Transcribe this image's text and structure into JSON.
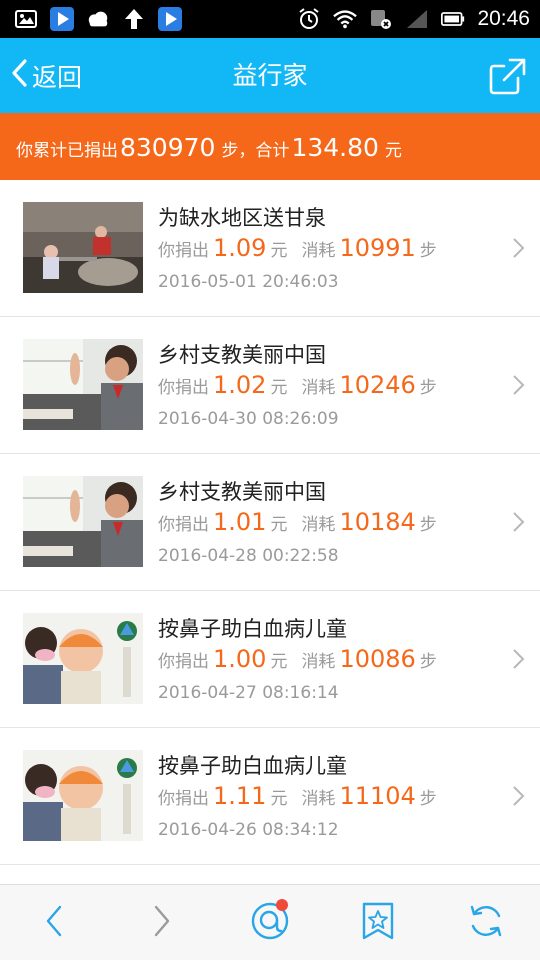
{
  "status_bar": {
    "time": "20:46",
    "left_icons": [
      "image-icon",
      "play-store-icon",
      "cloudy-weather-icon",
      "upload-arrow-icon",
      "play-store-icon"
    ],
    "right_icons": [
      "alarm-icon",
      "wifi-icon",
      "sim-icon",
      "signal-icon",
      "battery-icon"
    ]
  },
  "header": {
    "back_label": "返回",
    "title": "益行家",
    "share_icon": "share-icon"
  },
  "summary": {
    "prefix": "你累计已捐出",
    "steps": "830970",
    "steps_unit": "步，合计",
    "amount": "134.80",
    "amount_unit": "元"
  },
  "labels": {
    "donated": "你捐出",
    "yuan": "元",
    "consumed": "消耗",
    "steps": "步"
  },
  "donations": [
    {
      "title": "为缺水地区送甘泉",
      "amount": "1.09",
      "steps": "10991",
      "date": "2016-05-01 20:46:03"
    },
    {
      "title": "乡村支教美丽中国",
      "amount": "1.02",
      "steps": "10246",
      "date": "2016-04-30 08:26:09"
    },
    {
      "title": "乡村支教美丽中国",
      "amount": "1.01",
      "steps": "10184",
      "date": "2016-04-28 00:22:58"
    },
    {
      "title": "按鼻子助白血病儿童",
      "amount": "1.00",
      "steps": "10086",
      "date": "2016-04-27 08:16:14"
    },
    {
      "title": "按鼻子助白血病儿童",
      "amount": "1.11",
      "steps": "11104",
      "date": "2016-04-26 08:34:12"
    }
  ],
  "bottom_bar": [
    "back-arrow-icon",
    "forward-arrow-icon",
    "chat-icon",
    "favorite-icon",
    "refresh-icon"
  ],
  "colors": {
    "header": "#12b7f5",
    "summary": "#f5681a",
    "accent": "#f5681a",
    "text_gray": "#9a9a9a"
  }
}
